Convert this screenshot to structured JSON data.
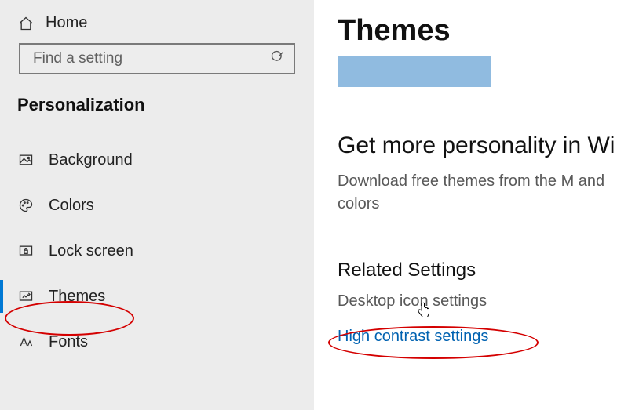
{
  "sidebar": {
    "home_label": "Home",
    "search_placeholder": "Find a setting",
    "section_header": "Personalization",
    "items": [
      {
        "label": "Background"
      },
      {
        "label": "Colors"
      },
      {
        "label": "Lock screen"
      },
      {
        "label": "Themes"
      },
      {
        "label": "Fonts"
      }
    ]
  },
  "content": {
    "title": "Themes",
    "more_heading": "Get more personality in Wi",
    "more_desc": "Download free themes from the M and colors",
    "related_heading": "Related Settings",
    "related_links": {
      "desktop_icon": "Desktop icon settings",
      "high_contrast": "High contrast settings"
    }
  }
}
